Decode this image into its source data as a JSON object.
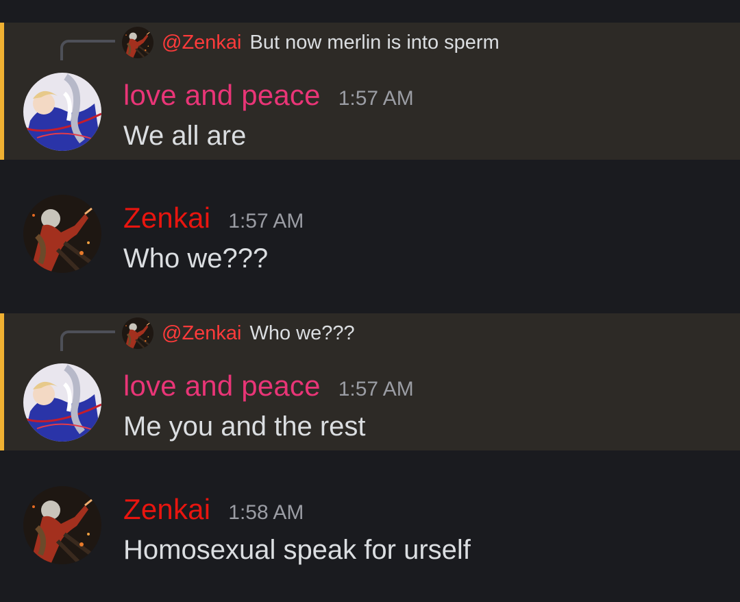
{
  "colors": {
    "background": "#1a1b1f",
    "mention_highlight": "#2d2a26",
    "mention_bar": "#f0b132",
    "author_love": "#e93577",
    "author_zenkai": "#e8150f",
    "mention_text": "#ff3b3b",
    "timestamp": "#9b9da4",
    "body_text": "#dbdee1"
  },
  "messages": [
    {
      "reply": {
        "mention": "@Zenkai",
        "text": "But now merlin is into sperm"
      },
      "author": "love and peace",
      "time": "1:57 AM",
      "text": "We all are"
    },
    {
      "author": "Zenkai",
      "time": "1:57 AM",
      "text": "Who we???"
    },
    {
      "reply": {
        "mention": "@Zenkai",
        "text": "Who we???"
      },
      "author": "love and peace",
      "time": "1:57 AM",
      "text": "Me you and the rest"
    },
    {
      "author": "Zenkai",
      "time": "1:58 AM",
      "text": "Homosexual speak for urself"
    }
  ]
}
